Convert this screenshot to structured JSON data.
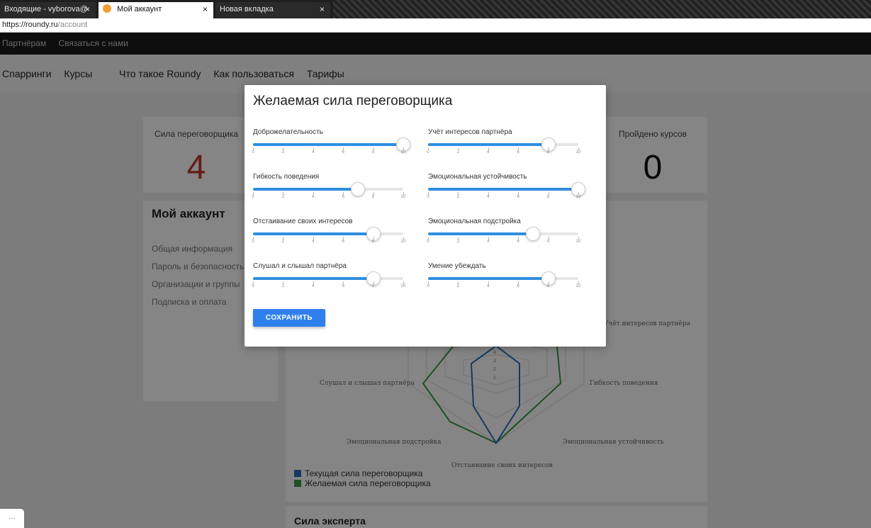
{
  "browser": {
    "tabs": [
      {
        "title": "Входящие - vyborova@",
        "active": false
      },
      {
        "title": "Мой аккаунт",
        "active": true
      },
      {
        "title": "Новая вкладка",
        "active": false
      }
    ],
    "close_glyph": "×",
    "url_host": "https://roundy.ru",
    "url_path": "/account"
  },
  "topnav": {
    "items": [
      "Партнёрам",
      "Связаться с нами"
    ]
  },
  "mainnav": {
    "items": [
      "Спарринги",
      "Курсы",
      "Что такое Roundy",
      "Как пользоваться",
      "Тарифы"
    ]
  },
  "stats": {
    "left_title": "Сила переговорщика",
    "left_value": "4",
    "right_title": "Пройдено курсов",
    "right_value": "0"
  },
  "account": {
    "title": "Мой аккаунт",
    "links": [
      "Общая информация",
      "Пароль и безопасность",
      "Организации и группы",
      "Подписка и оплата"
    ]
  },
  "radar": {
    "labels": [
      "Учёт интересов партнёра",
      "Гибкость поведения",
      "Эмоциональная устойчивость",
      "Отстаивание своих интересов",
      "Эмоциональная подстройка",
      "Слушал и слышал партнёра"
    ],
    "ticks": [
      "4",
      "3",
      "2",
      "1"
    ]
  },
  "legend": {
    "current": "Текущая сила переговорщика",
    "desired": "Желаемая сила переговорщика"
  },
  "expert_title": "Сила эксперта",
  "modal": {
    "title": "Желаемая сила переговорщика",
    "tick_labels": [
      "0",
      "2",
      "4",
      "6",
      "8",
      "10"
    ],
    "sliders": [
      {
        "label": "Доброжелательность",
        "value": 10
      },
      {
        "label": "Учёт интересов партнёра",
        "value": 8
      },
      {
        "label": "Гибкость поведения",
        "value": 7
      },
      {
        "label": "Эмоциональная устойчивость",
        "value": 10
      },
      {
        "label": "Отстаивание своих интересов",
        "value": 8
      },
      {
        "label": "Эмоциональная подстройка",
        "value": 7
      },
      {
        "label": "Слушал и слышал партнёра",
        "value": 8
      },
      {
        "label": "Умение убеждать",
        "value": 8
      }
    ],
    "save_label": "СОХРАНИТЬ"
  },
  "colors": {
    "accent": "#2f80ed",
    "slider_fill": "#2f8ee0",
    "current_series": "#2a6db8",
    "desired_series": "#3a9a4a",
    "stat_value": "#c0392b"
  },
  "corner_pill": "..."
}
